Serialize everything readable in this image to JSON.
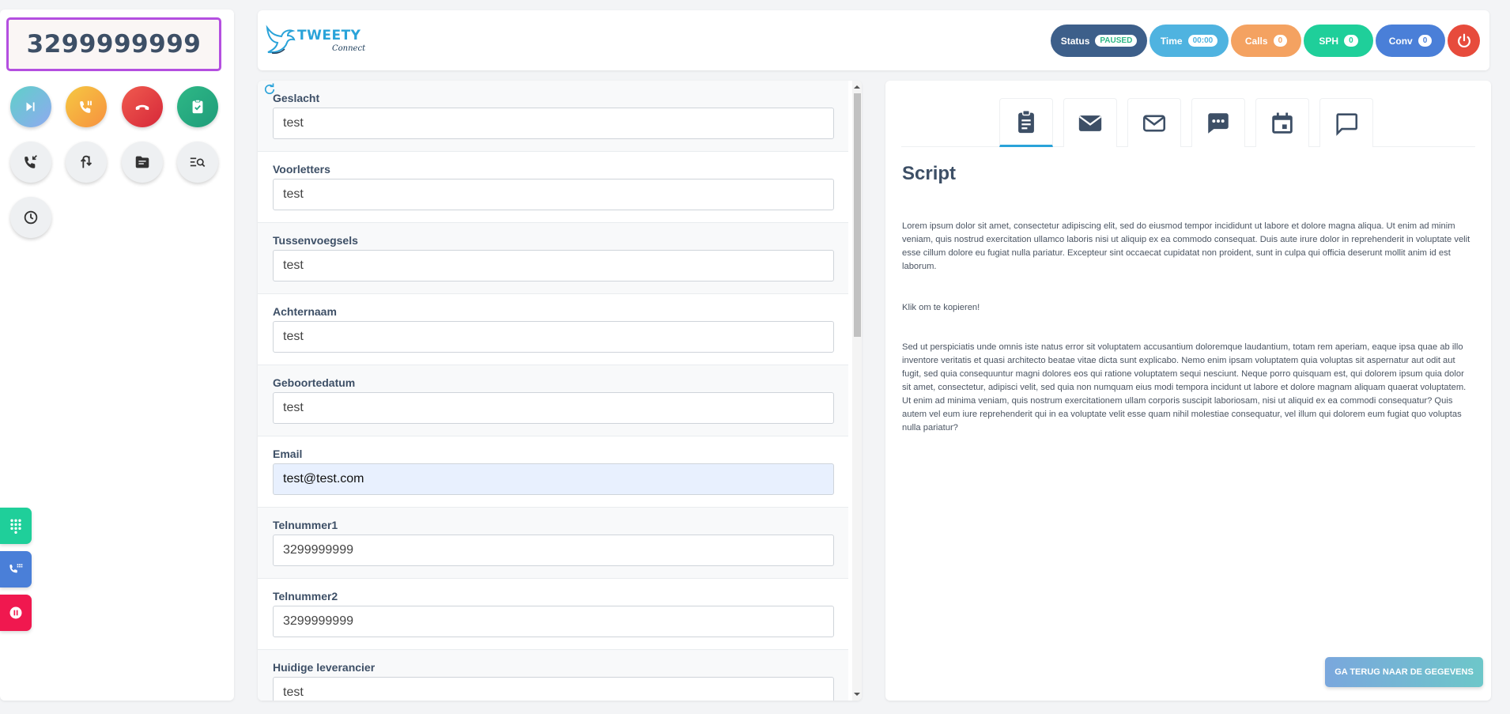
{
  "dialer": {
    "phone_number": "3299999999"
  },
  "header": {
    "logo_text": "TWEETY",
    "logo_subtext": "Connect",
    "status": {
      "label": "Status",
      "value": "PAUSED"
    },
    "time": {
      "label": "Time",
      "value": "00:00"
    },
    "calls": {
      "label": "Calls",
      "value": "0"
    },
    "sph": {
      "label": "SPH",
      "value": "0"
    },
    "conv": {
      "label": "Conv",
      "value": "0"
    }
  },
  "form": {
    "fields": [
      {
        "label": "Geslacht",
        "value": "test"
      },
      {
        "label": "Voorletters",
        "value": "test"
      },
      {
        "label": "Tussenvoegsels",
        "value": "test"
      },
      {
        "label": "Achternaam",
        "value": "test"
      },
      {
        "label": "Geboortedatum",
        "value": "test"
      },
      {
        "label": "Email",
        "value": "test@test.com"
      },
      {
        "label": "Telnummer1",
        "value": "3299999999"
      },
      {
        "label": "Telnummer2",
        "value": "3299999999"
      },
      {
        "label": "Huidige leverancier",
        "value": "test"
      }
    ]
  },
  "script": {
    "title": "Script",
    "paragraph1": "Lorem ipsum dolor sit amet, consectetur adipiscing elit, sed do eiusmod tempor incididunt ut labore et dolore magna aliqua. Ut enim ad minim veniam, quis nostrud exercitation ullamco laboris nisi ut aliquip ex ea commodo consequat. Duis aute irure dolor in reprehenderit in voluptate velit esse cillum dolore eu fugiat nulla pariatur. Excepteur sint occaecat cupidatat non proident, sunt in culpa qui officia deserunt mollit anim id est laborum.",
    "copy_hint": "Klik om te kopieren!",
    "paragraph2": "Sed ut perspiciatis unde omnis iste natus error sit voluptatem accusantium doloremque laudantium, totam rem aperiam, eaque ipsa quae ab illo inventore veritatis et quasi architecto beatae vitae dicta sunt explicabo. Nemo enim ipsam voluptatem quia voluptas sit aspernatur aut odit aut fugit, sed quia consequuntur magni dolores eos qui ratione voluptatem sequi nesciunt. Neque porro quisquam est, qui dolorem ipsum quia dolor sit amet, consectetur, adipisci velit, sed quia non numquam eius modi tempora incidunt ut labore et dolore magnam aliquam quaerat voluptatem. Ut enim ad minima veniam, quis nostrum exercitationem ullam corporis suscipit laboriosam, nisi ut aliquid ex ea commodi consequatur? Quis autem vel eum iure reprehenderit qui in ea voluptate velit esse quam nihil molestiae consequatur, vel illum qui dolorem eum fugiat quo voluptas nulla pariatur?",
    "back_button": "GA TERUG NAAR DE GEGEVENS"
  },
  "colors": {
    "accent": "#2aa3d9",
    "status_pill": "#3d5f8a",
    "time_pill": "#4fb3e0",
    "calls_pill": "#f4a261",
    "sph_pill": "#1fcf9a",
    "conv_pill": "#4a7fd8",
    "power": "#e74b3c"
  }
}
